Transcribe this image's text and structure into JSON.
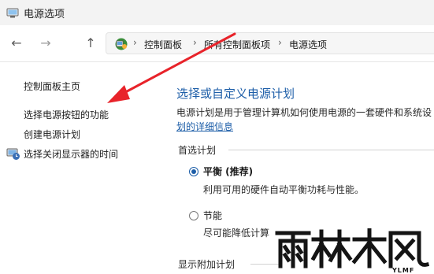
{
  "window": {
    "title": "电源选项"
  },
  "nav": {
    "back": "←",
    "forward": "→",
    "up": "↑"
  },
  "breadcrumb": {
    "sep": "›",
    "items": [
      "控制面板",
      "所有控制面板项",
      "电源选项"
    ]
  },
  "sidebar": {
    "items": [
      {
        "label": "控制面板主页"
      },
      {
        "label": "选择电源按钮的功能"
      },
      {
        "label": "创建电源计划"
      },
      {
        "label": "选择关闭显示器的时间"
      }
    ]
  },
  "main": {
    "title": "选择或自定义电源计划",
    "description": "电源计划是用于管理计算机如何使用电源的一套硬件和系统设",
    "description_link": "划的详细信息",
    "preferred_label": "首选计划",
    "plans": [
      {
        "name": "平衡 (推荐)",
        "desc": "利用可用的硬件自动平衡功耗与性能。",
        "selected": true
      },
      {
        "name": "节能",
        "desc": "尽可能降低计算",
        "selected": false
      }
    ],
    "additional_label": "显示附加计划"
  },
  "watermark": {
    "text": "雨林木风",
    "sub": "YLMF"
  },
  "colors": {
    "accent": "#1d5ea8",
    "arrow": "#e8232a"
  }
}
